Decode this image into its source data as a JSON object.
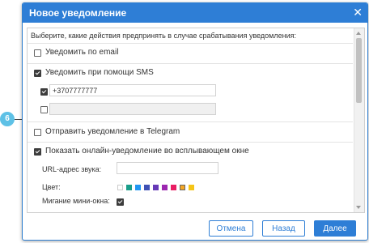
{
  "dialog": {
    "title": "Новое уведомление",
    "intro": "Выберите, какие действия предпринять в случае срабатывания уведомления:",
    "email": {
      "label": "Уведомить по email",
      "checked": false
    },
    "sms": {
      "label": "Уведомить при помощи SMS",
      "checked": true,
      "phones": [
        {
          "value": "+3707777777",
          "checked": true
        },
        {
          "value": "",
          "checked": false
        }
      ]
    },
    "telegram": {
      "label": "Отправить уведомление в Telegram",
      "checked": false
    },
    "popup": {
      "label": "Показать онлайн-уведомление во всплывающем окне",
      "checked": true,
      "sound_label": "URL-адрес звука:",
      "sound_value": "",
      "color_label": "Цвет:",
      "colors": [
        "#ffffff",
        "#1a9e8a",
        "#2196f3",
        "#3f51b5",
        "#673ab7",
        "#9c27b0",
        "#e91e63",
        "#f5a623",
        "#f5c518"
      ],
      "selected_color_index": 7,
      "blink_label": "Мигание мини-окна:",
      "blink_checked": true
    }
  },
  "buttons": {
    "cancel": "Отмена",
    "back": "Назад",
    "next": "Далее"
  },
  "callout": {
    "number": "6"
  }
}
